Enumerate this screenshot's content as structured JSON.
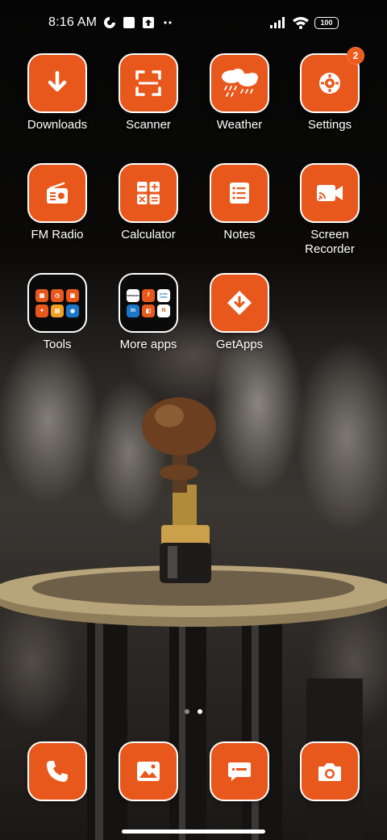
{
  "status_bar": {
    "time": "8:16 AM",
    "battery": "100",
    "icons": [
      "data-saver-icon",
      "square-icon",
      "upload-icon",
      "more-dots-icon",
      "signal-icon",
      "wifi-icon",
      "battery-icon"
    ]
  },
  "theme": {
    "tile_color": "#e8581c",
    "tile_border": "#ffffff"
  },
  "apps": [
    {
      "label": "Downloads",
      "icon": "download-arrow-icon"
    },
    {
      "label": "Scanner",
      "icon": "scanner-icon"
    },
    {
      "label": "Weather",
      "icon": "weather-cloud-icon"
    },
    {
      "label": "Settings",
      "icon": "gear-icon",
      "badge": "2"
    },
    {
      "label": "FM Radio",
      "icon": "radio-icon"
    },
    {
      "label": "Calculator",
      "icon": "calculator-icon"
    },
    {
      "label": "Notes",
      "icon": "notes-icon"
    },
    {
      "label": "Screen\nRecorder",
      "icon": "screen-recorder-icon"
    },
    {
      "label": "Tools",
      "icon": "folder-icon"
    },
    {
      "label": "More apps",
      "icon": "folder-icon"
    },
    {
      "label": "GetApps",
      "icon": "getapps-icon"
    }
  ],
  "folders": {
    "more_apps_minis": [
      "amazon",
      "f",
      "prime video",
      "in",
      "",
      "N"
    ]
  },
  "dock": [
    {
      "name": "phone",
      "icon": "phone-icon"
    },
    {
      "name": "gallery",
      "icon": "gallery-icon"
    },
    {
      "name": "messages",
      "icon": "messages-icon"
    },
    {
      "name": "camera",
      "icon": "camera-icon"
    }
  ],
  "pages": {
    "count": 2,
    "active": 2
  }
}
